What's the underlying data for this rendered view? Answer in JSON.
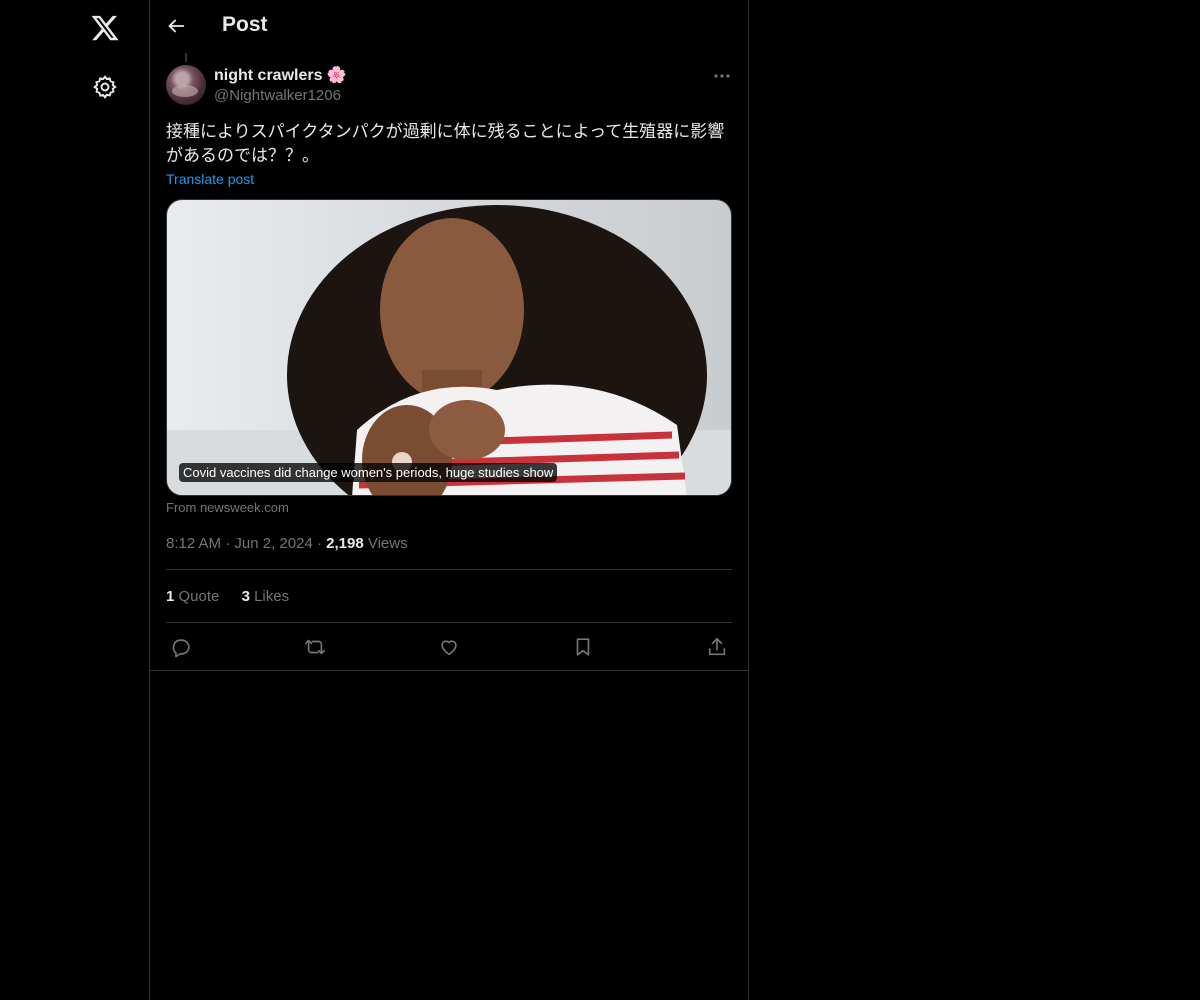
{
  "nav": {
    "logo_icon": "x-logo-icon",
    "settings_icon": "gear-icon"
  },
  "header": {
    "title": "Post",
    "back_icon": "arrow-left-icon"
  },
  "post": {
    "author": {
      "display_name": "night crawlers",
      "emoji": "🌸",
      "handle": "@Nightwalker1206"
    },
    "text": "接種によりスパイクタンパクが過剰に体に残ることによって生殖器に影響があるのでは？？。",
    "translate_label": "Translate post",
    "card": {
      "caption": "Covid vaccines did change women's periods, huge studies show",
      "source": "From newsweek.com"
    },
    "time": "8:12 AM",
    "date": "Jun 2, 2024",
    "views_count": "2,198",
    "views_label": "Views",
    "quotes_count": "1",
    "quotes_label": "Quote",
    "likes_count": "3",
    "likes_label": "Likes"
  },
  "actions": [
    "reply-icon",
    "repost-icon",
    "like-icon",
    "bookmark-icon",
    "share-icon"
  ],
  "colors": {
    "background": "#000000",
    "text": "#e7e9ea",
    "muted": "#71767b",
    "link": "#1d9bf0",
    "border": "#2f3336"
  }
}
